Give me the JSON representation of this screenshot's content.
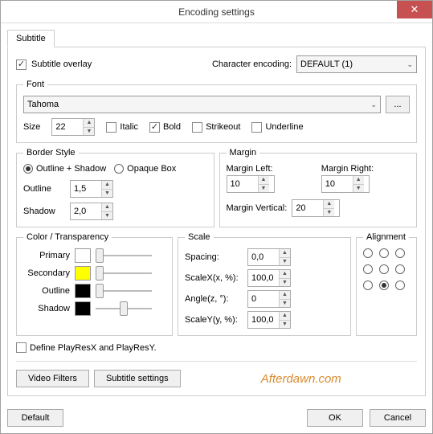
{
  "title": "Encoding settings",
  "tab": "Subtitle",
  "subtitle_overlay_label": "Subtitle overlay",
  "char_encoding_label": "Character encoding:",
  "char_encoding_value": "DEFAULT (1)",
  "font": {
    "legend": "Font",
    "name": "Tahoma",
    "browse": "...",
    "size_label": "Size",
    "size_value": "22",
    "italic": "Italic",
    "bold": "Bold",
    "strikeout": "Strikeout",
    "underline": "Underline"
  },
  "border": {
    "legend": "Border Style",
    "outline_shadow": "Outline + Shadow",
    "opaque_box": "Opaque Box",
    "outline_label": "Outline",
    "outline_value": "1,5",
    "shadow_label": "Shadow",
    "shadow_value": "2,0"
  },
  "margin": {
    "legend": "Margin",
    "left_label": "Margin Left:",
    "left_value": "10",
    "right_label": "Margin Right:",
    "right_value": "10",
    "vertical_label": "Margin Vertical:",
    "vertical_value": "20"
  },
  "color": {
    "legend": "Color / Transparency",
    "primary": "Primary",
    "secondary": "Secondary",
    "outline": "Outline",
    "shadow": "Shadow",
    "primary_hex": "#ffffff",
    "secondary_hex": "#ffff00",
    "outline_hex": "#000000",
    "shadow_hex": "#000000"
  },
  "scale": {
    "legend": "Scale",
    "spacing_label": "Spacing:",
    "spacing_value": "0,0",
    "scalex_label": "ScaleX(x, %):",
    "scalex_value": "100,0",
    "angle_label": "Angle(z, °):",
    "angle_value": "0",
    "scaley_label": "ScaleY(y, %):",
    "scaley_value": "100,0"
  },
  "alignment": {
    "legend": "Alignment"
  },
  "define_playres": "Define PlayResX and PlayResY.",
  "buttons": {
    "video_filters": "Video Filters",
    "subtitle_settings": "Subtitle settings",
    "default": "Default",
    "ok": "OK",
    "cancel": "Cancel"
  },
  "watermark": "Afterdawn.com"
}
